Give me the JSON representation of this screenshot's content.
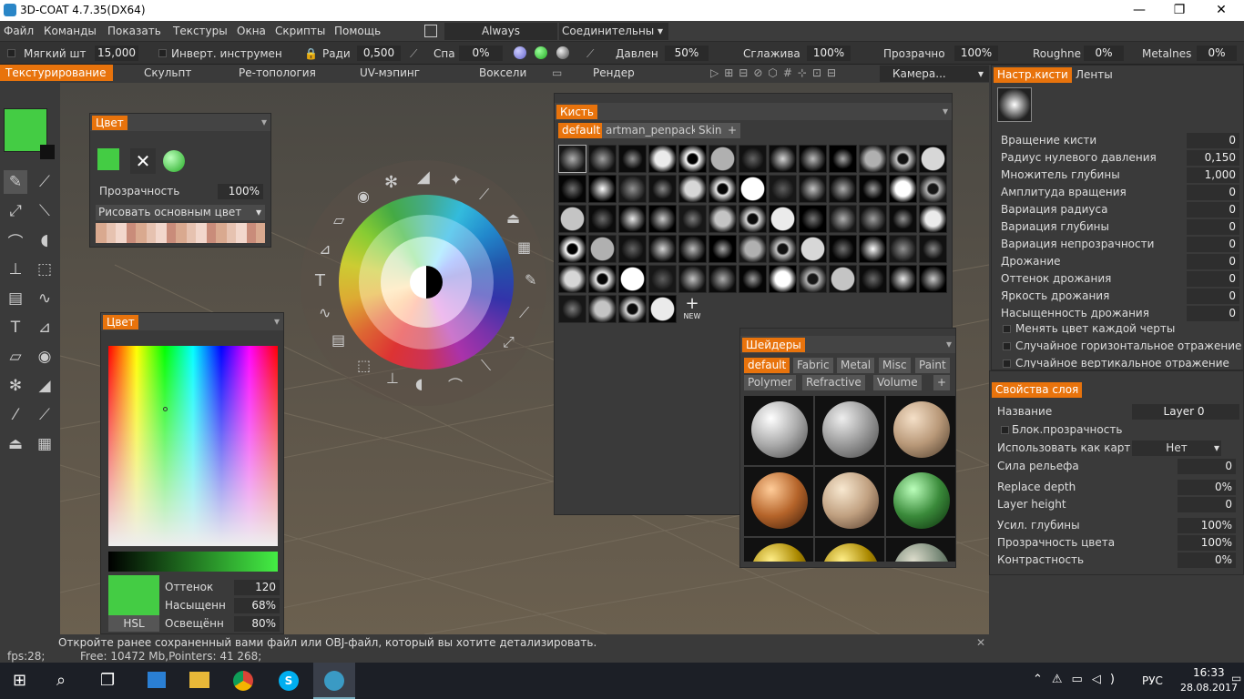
{
  "window": {
    "title": "3D-COAT 4.7.35(DX64)",
    "min": "—",
    "max": "❐",
    "close": "✕"
  },
  "menu": [
    "Файл",
    "Команды",
    "Показать",
    "Текстуры",
    "Окна",
    "Скрипты",
    "Помощь"
  ],
  "menu_extra": {
    "always": "Always",
    "connect": "Соединительны"
  },
  "toolbar": {
    "soft_label": "Мягкий шт",
    "soft_value": "15,000",
    "invert_label": "Инверт. инструмен",
    "radius_label": "Ради",
    "radius_value": "0,500",
    "spa_label": "Спа",
    "spa_value": "0%",
    "pressure_label": "Давлен",
    "pressure_value": "50%",
    "smooth_label": "Сглажива",
    "smooth_value": "100%",
    "opacity_label": "Прозрачно",
    "opacity_value": "100%",
    "rough_label": "Roughne",
    "rough_value": "0%",
    "metal_label": "Metalnes",
    "metal_value": "0%"
  },
  "rooms": {
    "items": [
      "Текстурирование",
      "Скульпт",
      "Ре-топология",
      "UV-мэпинг",
      "Воксели",
      "Рендер"
    ],
    "camera": "Камера..."
  },
  "color_panel": {
    "title": "Цвет",
    "opacity_label": "Прозрачность",
    "opacity_value": "100%",
    "mode": "Рисовать основным цвет",
    "main_color": "#44cc44"
  },
  "color_panel2": {
    "title": "Цвет",
    "hue_label": "Оттенок",
    "hue_value": "120",
    "sat_label": "Насыщенн",
    "sat_value": "68%",
    "light_label": "Освещённ",
    "light_value": "80%",
    "mode": "HSL"
  },
  "brush_panel": {
    "title": "Кисть",
    "tabs": [
      "default",
      "artman_penpack",
      "Skin"
    ],
    "plus": "+",
    "new_label": "NEW"
  },
  "shaders_panel": {
    "title": "Шейдеры",
    "tabs1": [
      "default",
      "Fabric",
      "Metal",
      "Misc",
      "Paint"
    ],
    "tabs2": [
      "Polymer",
      "Refractive",
      "Volume"
    ],
    "plus": "+"
  },
  "brush_settings": {
    "tab_active": "Настр.кисти",
    "tab2": "Ленты",
    "rows": [
      {
        "label": "Вращение кисти",
        "value": "0"
      },
      {
        "label": "Радиус нулевого давления",
        "value": "0,150"
      },
      {
        "label": "Множитель глубины",
        "value": "1,000"
      },
      {
        "label": "Амплитуда вращения",
        "value": "0"
      },
      {
        "label": "Вариация радиуса",
        "value": "0"
      },
      {
        "label": "Вариация глубины",
        "value": "0"
      },
      {
        "label": "Вариация непрозрачности",
        "value": "0"
      },
      {
        "label": "Дрожание",
        "value": "0"
      },
      {
        "label": "Оттенок дрожания",
        "value": "0"
      },
      {
        "label": "Яркость дрожания",
        "value": "0"
      },
      {
        "label": "Насыщенность дрожания",
        "value": "0"
      }
    ],
    "check1": "Менять цвет каждой черты",
    "check2": "Случайное горизонтальное отражение",
    "check3": "Случайное вертикальное отражение"
  },
  "layer_props": {
    "title": "Свойства слоя",
    "name_label": "Название",
    "name_value": "Layer 0",
    "lock_label": "Блок.прозрачность",
    "use_label": "Использовать как карт",
    "use_value": "Нет",
    "rows": [
      {
        "label": "Сила рельефа",
        "value": "0"
      },
      {
        "label": "Replace depth",
        "value": "0%"
      },
      {
        "label": "Layer height",
        "value": "0"
      },
      {
        "label": "Усил. глубины",
        "value": "100%"
      },
      {
        "label": "Прозрачность цвета",
        "value": "100%"
      },
      {
        "label": "Контрастность",
        "value": "0%"
      }
    ]
  },
  "status": {
    "hint": "Откройте ранее сохраненный вами файл или OBJ-файл, который вы хотите детализировать.",
    "fps": "fps:28;",
    "mem": "Free: 10472 Mb,Pointers: 41 268;"
  },
  "taskbar": {
    "lang": "РУС",
    "time": "16:33",
    "date": "28.08.2017"
  }
}
